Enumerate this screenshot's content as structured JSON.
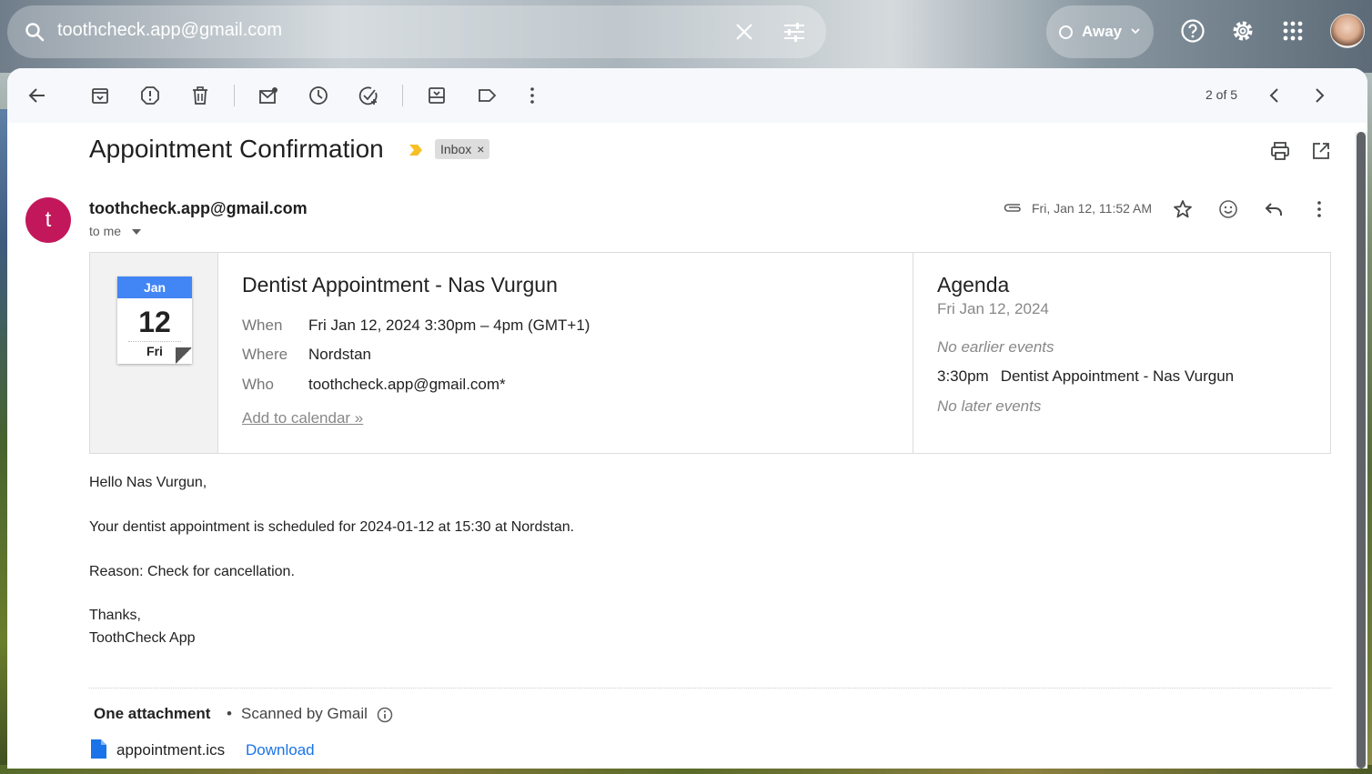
{
  "search": {
    "query": "toothcheck.app@gmail.com"
  },
  "status": {
    "label": "Away"
  },
  "toolbar": {
    "pager": "2 of 5"
  },
  "message": {
    "subject": "Appointment Confirmation",
    "label_chip": "Inbox",
    "label_chip_close": "×",
    "sender_initial": "t",
    "sender": "toothcheck.app@gmail.com",
    "to": "to me",
    "date": "Fri, Jan 12, 11:52 AM"
  },
  "invite": {
    "cal_month": "Jan",
    "cal_day": "12",
    "cal_dow": "Fri",
    "title": "Dentist Appointment - Nas Vurgun",
    "when_label": "When",
    "when_value": "Fri Jan 12, 2024 3:30pm – 4pm (GMT+1)",
    "where_label": "Where",
    "where_value": "Nordstan",
    "who_label": "Who",
    "who_value": "toothcheck.app@gmail.com*",
    "add_to_calendar": "Add to calendar »"
  },
  "agenda": {
    "heading": "Agenda",
    "date": "Fri Jan 12, 2024",
    "no_earlier": "No earlier events",
    "event_time": "3:30pm",
    "event_title": "Dentist Appointment - Nas Vurgun",
    "no_later": "No later events"
  },
  "body": {
    "greeting": "Hello Nas Vurgun,",
    "line1": "Your dentist appointment is scheduled for 2024-01-12 at 15:30 at Nordstan.",
    "line2": "Reason: Check for cancellation.",
    "thanks": "Thanks,",
    "signature": "ToothCheck App"
  },
  "attachments": {
    "title": "One attachment",
    "separator": "•",
    "scanned": "Scanned by Gmail",
    "file_name": "appointment.ics",
    "download": "Download"
  },
  "colors": {
    "sender_avatar": "#c2185b",
    "calendar_header": "#4285f4",
    "link": "#1a73e8",
    "importance_marker": "#f6c026"
  }
}
